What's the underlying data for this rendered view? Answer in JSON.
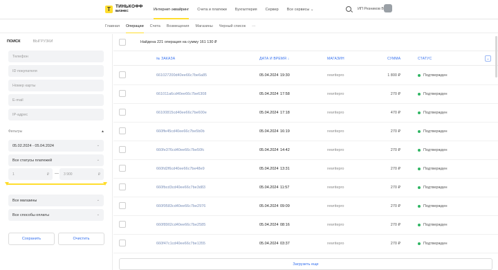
{
  "header": {
    "logo_mark": "Т",
    "logo_line1": "ТИНЬКОФФ",
    "logo_line2": "БИЗНЕС",
    "nav": [
      "Интернет-эквайринг",
      "Счета и платежи",
      "Бухгалтерия",
      "Сервер",
      "Все сервисы"
    ],
    "user": "ИП Резников В."
  },
  "subnav": [
    "Главная",
    "Операции",
    "Счета",
    "Возмещения",
    "Магазины",
    "Черный список",
    "···"
  ],
  "sidebar": {
    "tabs": [
      "ПОИСК",
      "ВЫГРУЗКИ"
    ],
    "fields": [
      "Телефон",
      "ID покупателя",
      "Номер карты",
      "E-mail",
      "IP-адрес"
    ],
    "filters_label": "Фильтры",
    "date_range": "05.02.2024 - 05.04.2024",
    "status_filter": "Все статусы платежей",
    "amount_from": "1",
    "amount_to": "3 900",
    "currency": "₽",
    "slider_min": 0,
    "slider_max": 1,
    "shops": "Все магазины",
    "payment_methods": "Все способы оплаты",
    "save_label": "Сохранить",
    "clear_label": "Очистить"
  },
  "main": {
    "found_text": "Найдена 221 операция на сумму 161 130 ₽",
    "columns": [
      "№ ЗАКАЗА",
      "ДАТА И ВРЕМЯ ↓",
      "МАГАЗИН",
      "СУММА",
      "СТАТУС"
    ],
    "rows": [
      {
        "order": "661027200d40ee66c7be6a85",
        "date": "05.04.2024",
        "time": "19:30",
        "shop": "rewritepro",
        "sum": "1 800 ₽",
        "status": "Подтвержден"
      },
      {
        "order": "661011a6cd40ee66c7be6308",
        "date": "05.04.2024",
        "time": "17:58",
        "shop": "rewritepro",
        "sum": "270 ₽",
        "status": "Подтвержден"
      },
      {
        "order": "66100815cd40ee66c7be600e",
        "date": "05.04.2024",
        "time": "17:18",
        "shop": "rewritepro",
        "sum": "470 ₽",
        "status": "Подтвержден"
      },
      {
        "order": "660ffe45cd40ee66c7be5b0b",
        "date": "05.04.2024",
        "time": "16:19",
        "shop": "rewritepro",
        "sum": "270 ₽",
        "status": "Подтвержден"
      },
      {
        "order": "660fe376cd40ee66c7be50fc",
        "date": "05.04.2024",
        "time": "14:42",
        "shop": "rewritepro",
        "sum": "270 ₽",
        "status": "Подтвержден"
      },
      {
        "order": "660fd2f6cd40ee66c7be48e9",
        "date": "05.04.2024",
        "time": "13:31",
        "shop": "rewritepro",
        "sum": "270 ₽",
        "status": "Подтвержден"
      },
      {
        "order": "660fbcd3cd40ee66c7be3d83",
        "date": "05.04.2024",
        "time": "11:57",
        "shop": "rewritepro",
        "sum": "270 ₽",
        "status": "Подтвержден"
      },
      {
        "order": "660f9583cd40ee66c7be2976",
        "date": "05.04.2024",
        "time": "09:09",
        "shop": "rewritepro",
        "sum": "270 ₽",
        "status": "Подтвержден"
      },
      {
        "order": "660f8902cd40ee66c7be2585",
        "date": "05.04.2024",
        "time": "08:16",
        "shop": "rewritepro",
        "sum": "270 ₽",
        "status": "Подтвержден"
      },
      {
        "order": "660f47c1cd40ee66c7be1355",
        "date": "05.04.2024",
        "time": "03:37",
        "shop": "rewritepro",
        "sum": "270 ₽",
        "status": "Подтвержден"
      }
    ],
    "load_more": "Загрузить еще"
  },
  "colors": {
    "accent": "#ffdd2d",
    "link": "#336fee",
    "status_ok": "#2fb562"
  },
  "icons": [
    "search-icon",
    "bell-icon",
    "chevron-down-icon",
    "expand-icon",
    "chat-icon"
  ]
}
